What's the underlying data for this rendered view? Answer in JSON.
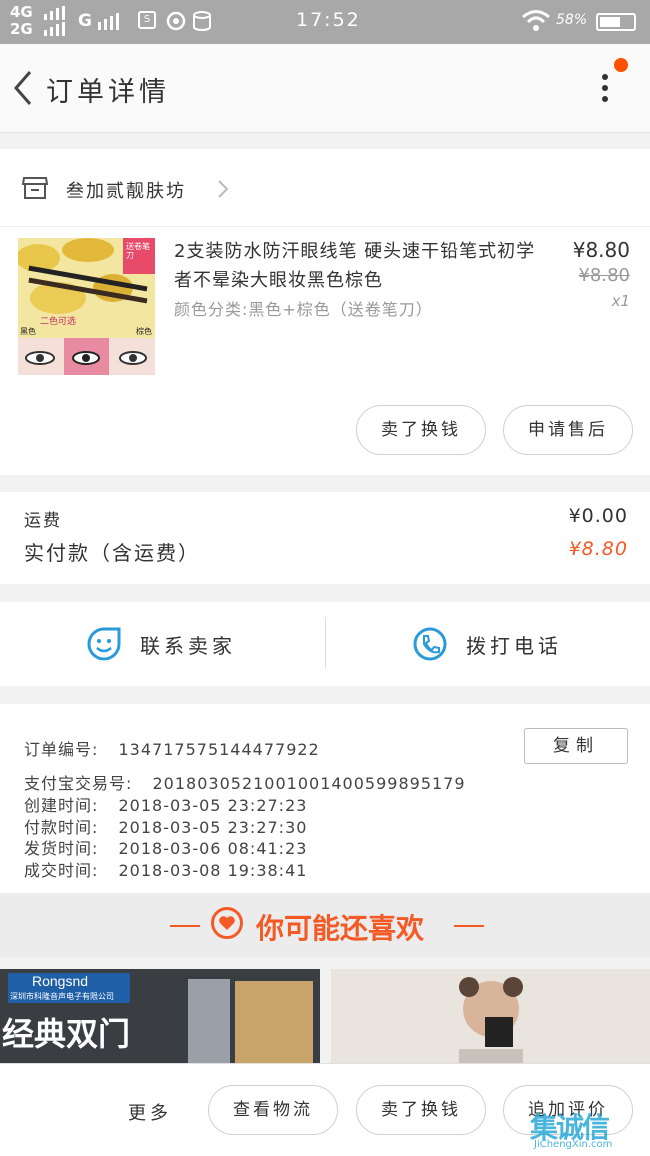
{
  "status_bar": {
    "network_top": "4G",
    "network_bottom": "2G",
    "network_g": "G",
    "time": "17:52",
    "battery": "58%",
    "icons": [
      "signal-icon",
      "sim-icon",
      "sync-icon",
      "data-icon",
      "wifi-icon",
      "battery-icon"
    ]
  },
  "header": {
    "title": "订单详情",
    "back_icon": "back-arrow-icon",
    "more_icon": "more-vertical-icon",
    "accent": "#ff5000"
  },
  "shop": {
    "name": "叁加贰靓肤坊",
    "icon": "store-icon"
  },
  "product": {
    "title": "2支装防水防汗眼线笔 硬头速干铅笔式初学者不晕染大眼妆黑色棕色",
    "sku": "颜色分类:黑色+棕色（送卷笔刀）",
    "price": "¥8.80",
    "original_price": "¥8.80",
    "quantity": "x1",
    "image_labels": [
      "送卷笔刀",
      "二色可选",
      "黑色",
      "棕色"
    ]
  },
  "item_actions": {
    "sell_trade": "卖了换钱",
    "after_sale": "申请售后"
  },
  "summary": {
    "shipping_label": "运费",
    "shipping_value": "¥0.00",
    "paid_label": "实付款（含运费）",
    "paid_value": "¥8.80",
    "paid_color": "#f45a25"
  },
  "contact": {
    "seller": "联系卖家",
    "call": "拨打电话",
    "icon_color": "#2a9bd8"
  },
  "order_info": {
    "order_no_label": "订单编号:",
    "order_no": "134717575144477922",
    "copy": "复制",
    "alipay_label": "支付宝交易号:",
    "alipay_no": "2018030521001001400599895179",
    "created_label": "创建时间:",
    "created": "2018-03-05 23:27:23",
    "paid_label": "付款时间:",
    "paid": "2018-03-05 23:27:30",
    "shipped_label": "发货时间:",
    "shipped": "2018-03-06 08:41:23",
    "completed_label": "成交时间:",
    "completed": "2018-03-08 19:38:41"
  },
  "recommend": {
    "title": "你可能还喜欢",
    "card1_brand": "Rongsnd",
    "card1_company": "深圳市科隆音声电子有限公司",
    "card1_slogan": "经典双门"
  },
  "bottom_bar": {
    "more": "更多",
    "logistics": "查看物流",
    "sell_trade": "卖了换钱",
    "review": "追加评价"
  },
  "watermark": {
    "word": "集诚信",
    "url": "JiChengXin.com"
  }
}
